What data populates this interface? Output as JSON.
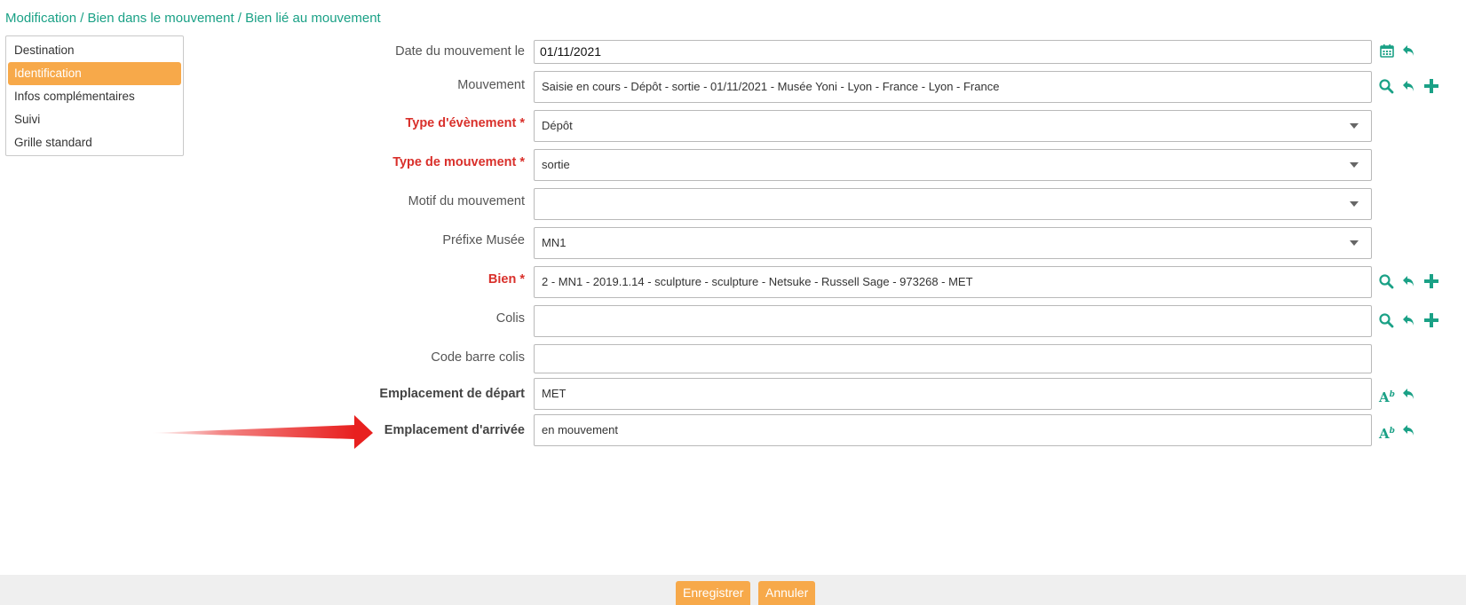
{
  "breadcrumb": "Modification / Bien dans le mouvement / Bien lié au mouvement",
  "side_menu": {
    "items": [
      {
        "label": "Destination"
      },
      {
        "label": "Identification",
        "active": true
      },
      {
        "label": "Infos complémentaires"
      },
      {
        "label": "Suivi"
      },
      {
        "label": "Grille standard"
      }
    ]
  },
  "form": {
    "date": {
      "label": "Date du mouvement le",
      "value": "01/11/2021"
    },
    "mouvement": {
      "label": "Mouvement",
      "value": "Saisie en cours - Dépôt - sortie - 01/11/2021 - Musée Yoni - Lyon - France - Lyon - France"
    },
    "type_evenement": {
      "label": "Type d'évènement *",
      "value": "Dépôt"
    },
    "type_mouvement": {
      "label": "Type de mouvement *",
      "value": "sortie"
    },
    "motif": {
      "label": "Motif du mouvement",
      "value": ""
    },
    "prefixe": {
      "label": "Préfixe Musée",
      "value": "MN1"
    },
    "bien": {
      "label": "Bien *",
      "value": "2 - MN1 - 2019.1.14 - sculpture - sculpture - Netsuke - Russell Sage - 973268 - MET"
    },
    "colis": {
      "label": "Colis",
      "value": ""
    },
    "code_barre": {
      "label": "Code barre colis",
      "value": ""
    },
    "emplacement_depart": {
      "label": "Emplacement de départ",
      "value": "MET"
    },
    "emplacement_arrivee": {
      "label": "Emplacement d'arrivée",
      "value": "en mouvement"
    }
  },
  "icons": {
    "ab_text": "A",
    "ab_sup": "b"
  },
  "buttons": {
    "save": "Enregistrer",
    "cancel": "Annuler"
  },
  "colors": {
    "accent": "#1aa186",
    "active_menu": "#f7a94a",
    "required_label": "#d9302b",
    "arrow": "#e8201f"
  }
}
